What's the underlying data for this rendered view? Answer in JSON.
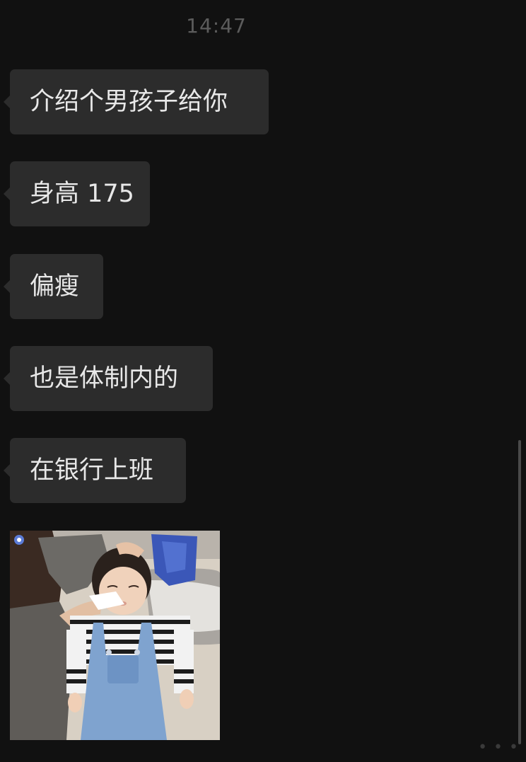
{
  "chat": {
    "timestamp": "14:47",
    "messages": [
      {
        "type": "text",
        "text": "介绍个男孩子给你"
      },
      {
        "type": "text",
        "text": "身高 175"
      },
      {
        "type": "text",
        "text": "偏瘦"
      },
      {
        "type": "text",
        "text": "也是体制内的"
      },
      {
        "type": "text",
        "text": "在银行上班"
      },
      {
        "type": "image"
      }
    ],
    "more_dots": "• • •"
  },
  "colors": {
    "background": "#111111",
    "bubble": "#2c2c2c",
    "text": "#e8e8e8",
    "timestamp": "#5c5c5c"
  }
}
